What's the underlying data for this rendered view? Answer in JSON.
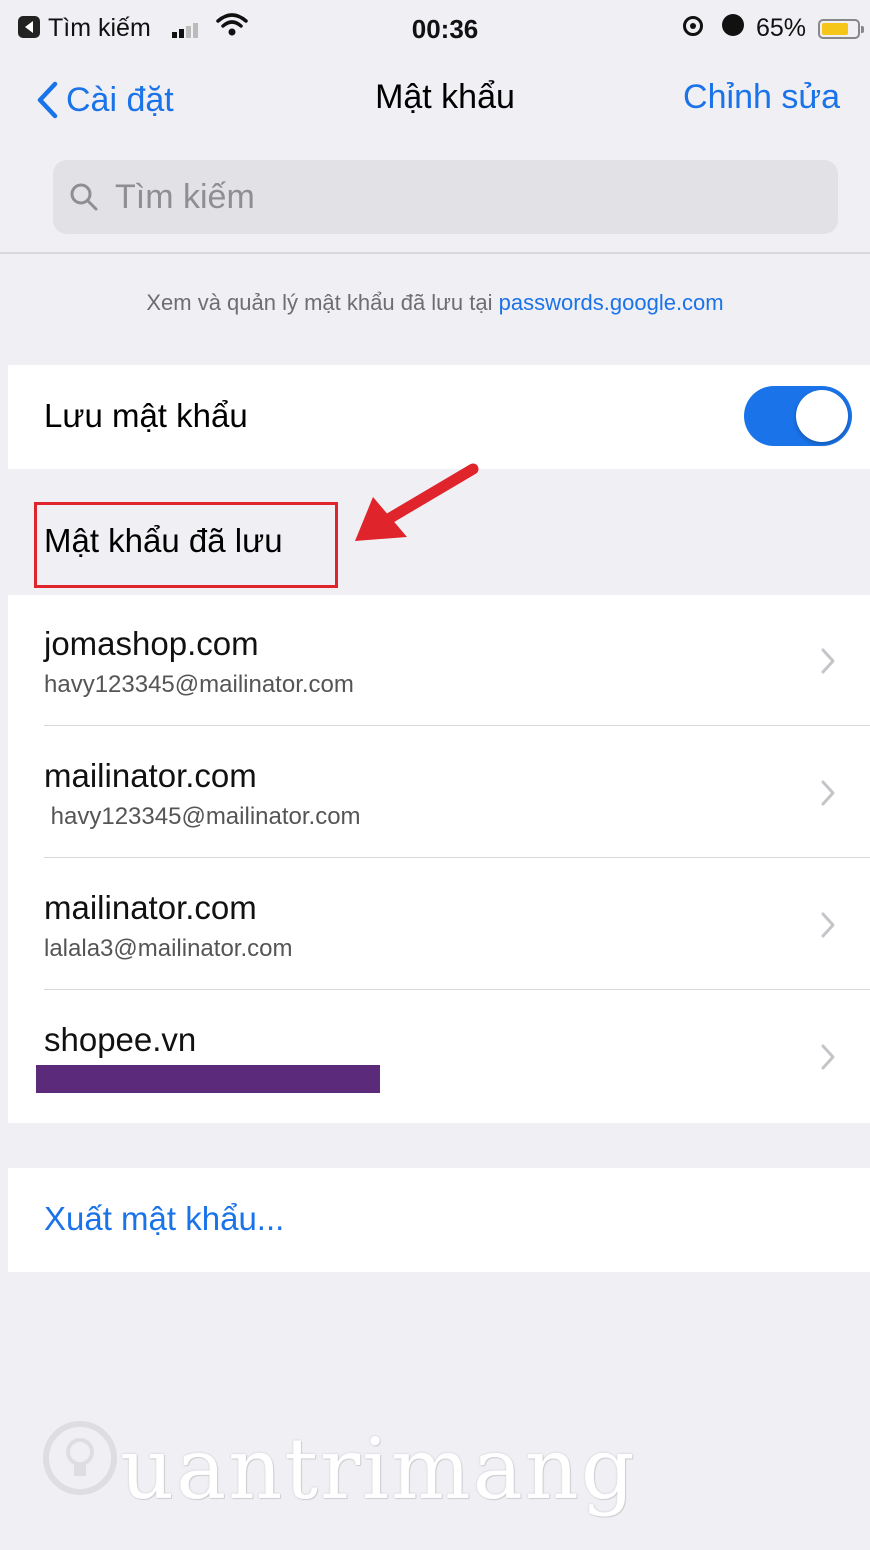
{
  "status_bar": {
    "back_app": "Tìm kiếm",
    "time": "00:36",
    "battery": "65%"
  },
  "nav": {
    "back_label": "Cài đặt",
    "title": "Mật khẩu",
    "edit_label": "Chỉnh sửa"
  },
  "search": {
    "placeholder": "Tìm kiếm"
  },
  "info": {
    "text": "Xem và quản lý mật khẩu đã lưu tại ",
    "link": "passwords.google.com"
  },
  "save_passwords": {
    "label": "Lưu mật khẩu",
    "enabled": true
  },
  "saved_section": {
    "header": "Mật khẩu đã lưu"
  },
  "passwords": [
    {
      "site": "jomashop.com",
      "username": "havy123345@mailinator.com"
    },
    {
      "site": "mailinator.com",
      "username": " havy123345@mailinator.com"
    },
    {
      "site": "mailinator.com",
      "username": "lalala3@mailinator.com"
    },
    {
      "site": "shopee.vn",
      "username": ""
    }
  ],
  "export": {
    "label": "Xuất mật khẩu..."
  },
  "watermark": {
    "text": "uantrimang"
  },
  "colors": {
    "accent": "#1a73e8",
    "background": "#efeff4",
    "highlight": "#e0242b",
    "redaction": "#5c2a7a"
  }
}
